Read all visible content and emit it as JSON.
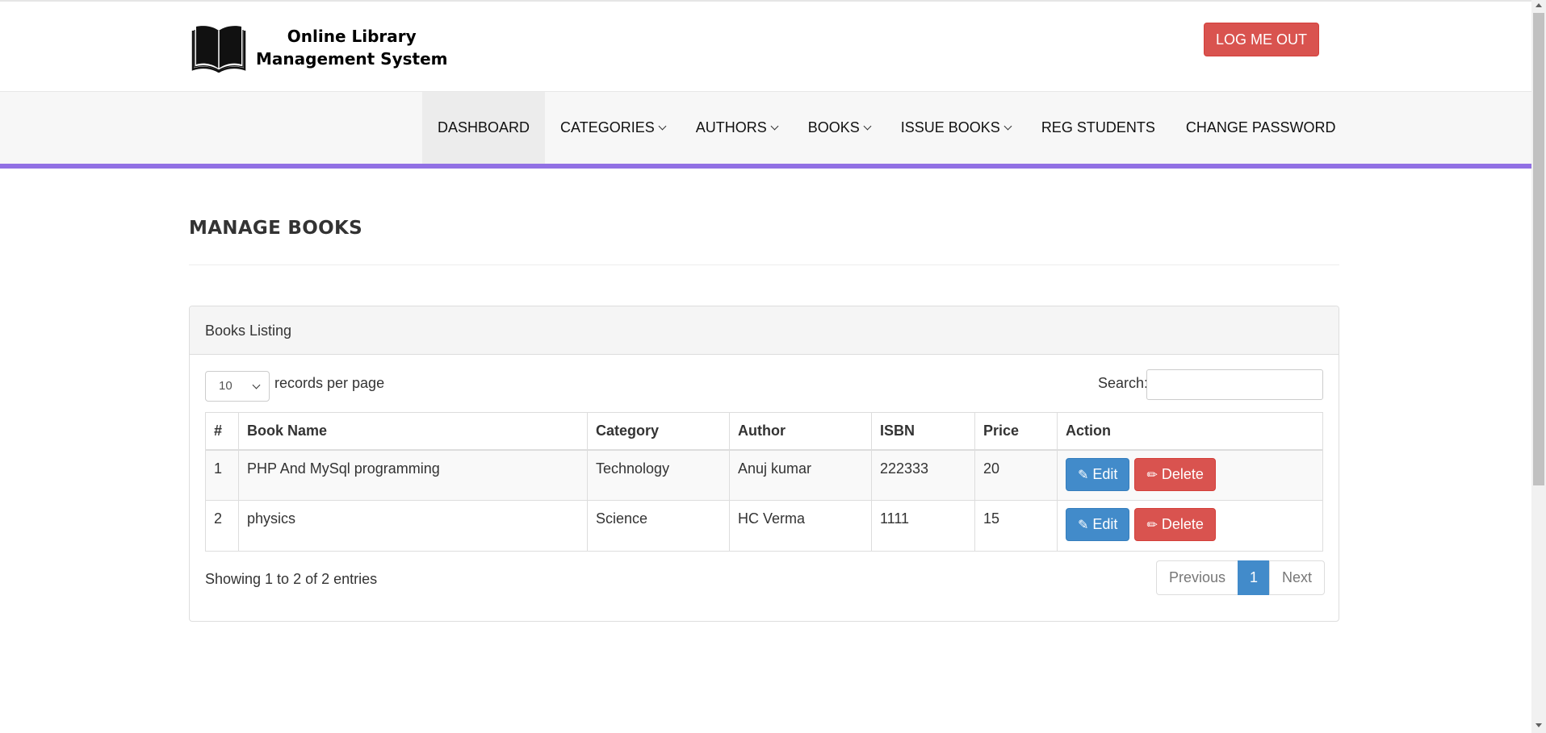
{
  "header": {
    "logo_line1": "Online Library",
    "logo_line2": "Management System",
    "logout_label": "LOG ME OUT"
  },
  "nav": {
    "items": [
      {
        "label": "DASHBOARD",
        "dropdown": false,
        "active": true
      },
      {
        "label": "CATEGORIES",
        "dropdown": true
      },
      {
        "label": "AUTHORS",
        "dropdown": true
      },
      {
        "label": "BOOKS",
        "dropdown": true
      },
      {
        "label": "ISSUE BOOKS",
        "dropdown": true
      },
      {
        "label": "REG STUDENTS",
        "dropdown": false
      },
      {
        "label": "CHANGE PASSWORD",
        "dropdown": false
      }
    ]
  },
  "page": {
    "title": "MANAGE BOOKS"
  },
  "panel": {
    "heading": "Books Listing",
    "length_value": "10",
    "length_label": "records per page",
    "search_label": "Search:",
    "search_value": ""
  },
  "table": {
    "headers": [
      "#",
      "Book Name",
      "Category",
      "Author",
      "ISBN",
      "Price",
      "Action"
    ],
    "rows": [
      {
        "num": "1",
        "book": "PHP And MySql programming",
        "category": "Technology",
        "author": "Anuj kumar",
        "isbn": "222333",
        "price": "20"
      },
      {
        "num": "2",
        "book": "physics",
        "category": "Science",
        "author": "HC Verma",
        "isbn": "1111",
        "price": "15"
      }
    ],
    "edit_label": "Edit",
    "delete_label": "Delete"
  },
  "footer": {
    "info": "Showing 1 to 2 of 2 entries",
    "prev_label": "Previous",
    "current_page": "1",
    "next_label": "Next"
  },
  "colors": {
    "accent": "#9170e4",
    "primary": "#428bca",
    "danger": "#d9534f"
  }
}
